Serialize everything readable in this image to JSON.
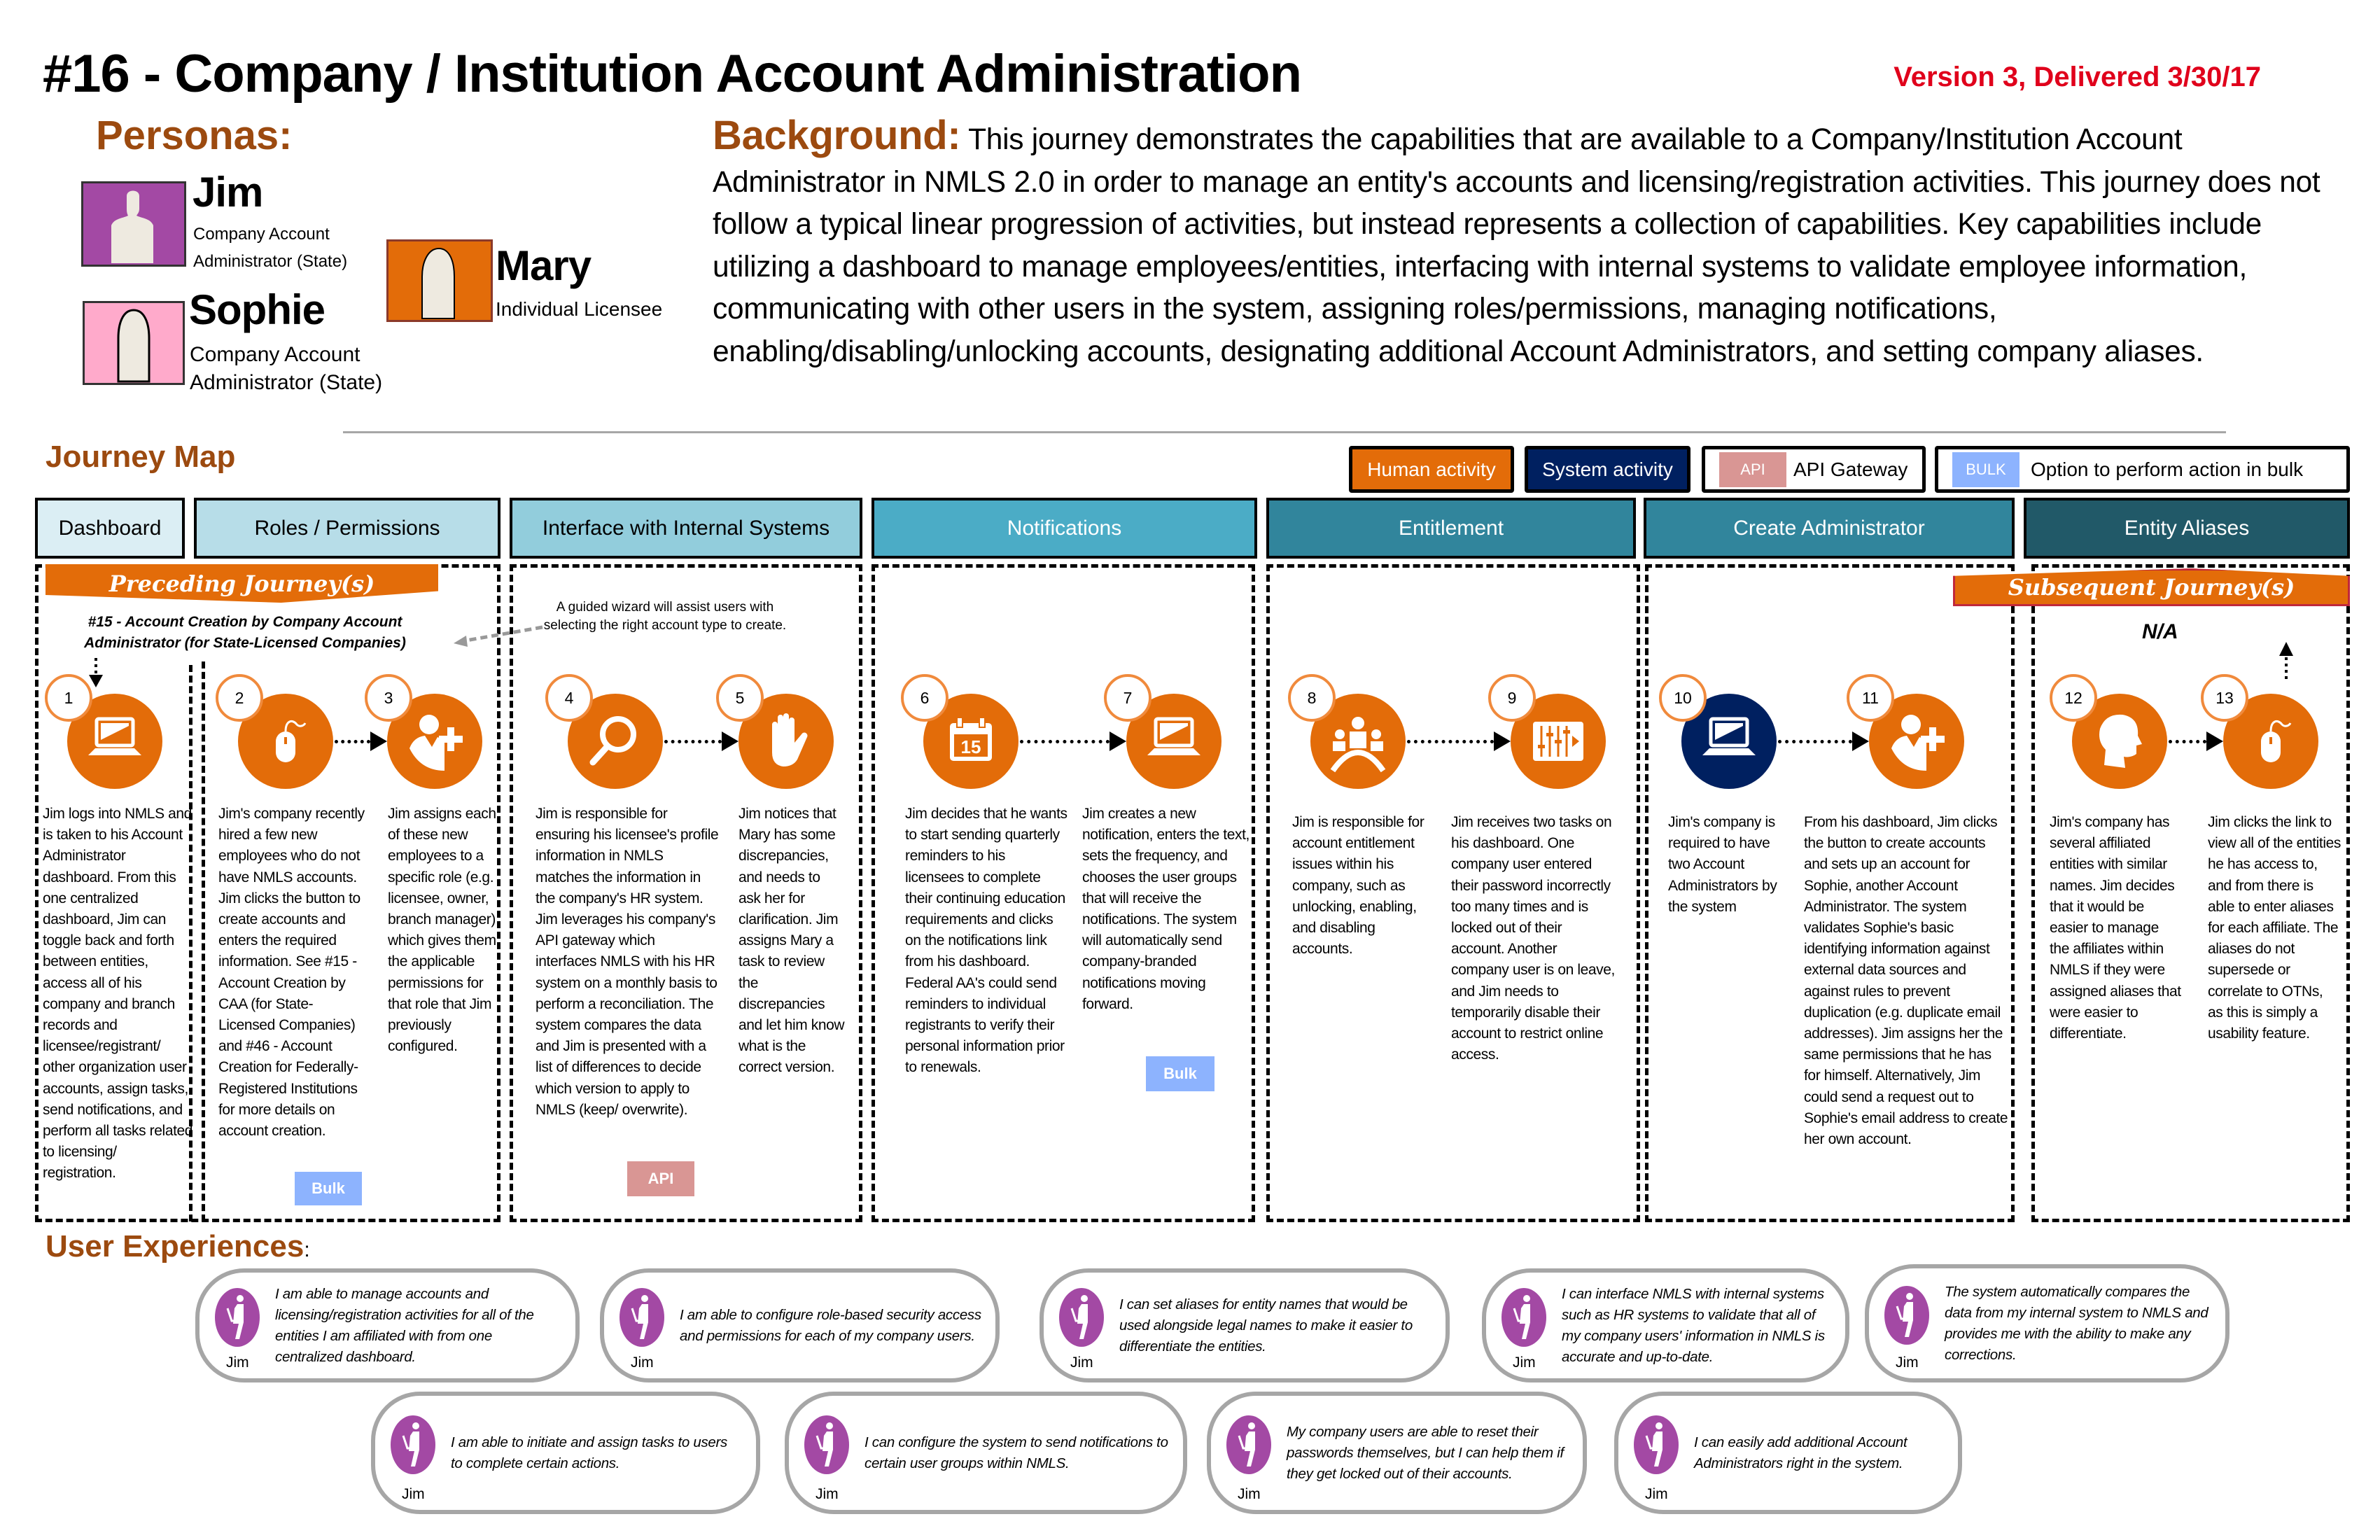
{
  "header": {
    "title": "#16 - Company / Institution Account Administration",
    "version": "Version 3, Delivered 3/30/17"
  },
  "personas": {
    "label": "Personas:",
    "items": [
      {
        "name": "Jim",
        "role_line1": "Company Account",
        "role_line2": "Administrator (State)",
        "color": "#a349a4"
      },
      {
        "name": "Sophie",
        "role_line1": "Company Account",
        "role_line2": "Administrator (State)",
        "color": "#ffaacb"
      },
      {
        "name": "Mary",
        "role_line1": "Individual Licensee",
        "color": "#e36c09"
      }
    ]
  },
  "background": {
    "label": "Background:",
    "text": "This journey demonstrates the capabilities that are available to a Company/Institution Account Administrator in NMLS 2.0 in order to manage an entity's accounts and licensing/registration activities. This journey does not follow a typical linear progression of activities, but instead represents a collection of capabilities. Key capabilities include utilizing a dashboard to manage employees/entities, interfacing with internal systems to validate employee information, communicating with other users in the system, assigning roles/permissions, managing notifications, enabling/disabling/unlocking accounts, designating additional Account Administrators, and setting company aliases."
  },
  "journey_map": {
    "label": "Journey Map",
    "legend": {
      "human": "Human activity",
      "system": "System activity",
      "api_tag": "API",
      "api": "API Gateway",
      "bulk_tag": "BULK",
      "bulk": "Option to perform action in bulk"
    },
    "colors": {
      "human": "#e36c09",
      "system": "#002060",
      "api": "#d99694",
      "bulk": "#8db3fe"
    },
    "phases": [
      {
        "label": "Dashboard",
        "color": "#dbeef4",
        "text_color": "#000"
      },
      {
        "label": "Roles / Permissions",
        "color": "#b7dde8",
        "text_color": "#000"
      },
      {
        "label": "Interface with Internal Systems",
        "color": "#92cddc",
        "text_color": "#000"
      },
      {
        "label": "Notifications",
        "color": "#4bacc6",
        "text_color": "#fff"
      },
      {
        "label": "Entitlement",
        "color": "#31859c",
        "text_color": "#fff"
      },
      {
        "label": "Create Administrator",
        "color": "#31859c",
        "text_color": "#fff"
      },
      {
        "label": "Entity Aliases",
        "color": "#215968",
        "text_color": "#fff"
      }
    ],
    "preceding": {
      "label": "Preceding Journey(s)",
      "line1": "#15 - Account Creation by Company Account",
      "line2": "Administrator (for State-Licensed Companies)"
    },
    "wizard_note": {
      "line1": "A guided wizard will assist users with",
      "line2": "selecting the right account type to create."
    },
    "subsequent": {
      "label": "Subsequent Journey(s)",
      "value": "N/A"
    },
    "steps": [
      {
        "num": "1",
        "icon": "laptop",
        "actor": "human",
        "text": "Jim logs into NMLS and is taken to his Account Administrator dashboard. From this one centralized dashboard, Jim can toggle back and forth between entities, access all of his company and branch records and licensee/registrant/ other organization user accounts, assign tasks, send notifications, and perform all tasks related to licensing/ registration."
      },
      {
        "num": "2",
        "icon": "mouse",
        "actor": "human",
        "tag": "Bulk",
        "text": "Jim's company recently hired a few new employees who do not have NMLS accounts.  Jim clicks the button to create accounts and enters the required information. See #15 - Account Creation by CAA (for State-Licensed Companies) and #46 - Account Creation for Federally-Registered Institutions for more details on account creation."
      },
      {
        "num": "3",
        "icon": "person-add",
        "actor": "human",
        "text": "Jim assigns each of these new employees to a specific role (e.g. licensee, owner, branch manager) which gives them the applicable permissions for that role that Jim previously configured."
      },
      {
        "num": "4",
        "icon": "magnifier",
        "actor": "human",
        "tag": "API",
        "text": "Jim is responsible for ensuring his licensee's profile information in NMLS matches the information in the company's HR system. Jim leverages his company's API gateway which interfaces NMLS with his HR system on a monthly basis to perform a reconciliation. The system compares the data and Jim is presented with a list of differences to decide which version to apply to NMLS (keep/ overwrite)."
      },
      {
        "num": "5",
        "icon": "hand",
        "actor": "human",
        "text": "Jim notices that Mary has some discrepancies, and needs to ask her for clarification. Jim assigns Mary a task to review the discrepancies and let him know what is the correct version."
      },
      {
        "num": "6",
        "icon": "calendar",
        "actor": "human",
        "icon_text": "15",
        "text": "Jim decides that he wants to start sending quarterly reminders to his licensees to complete their continuing education requirements and clicks on the notifications link from his dashboard. Federal AA's could send reminders to individual registrants to verify their personal information prior to renewals."
      },
      {
        "num": "7",
        "icon": "laptop",
        "actor": "human",
        "tag": "Bulk",
        "text": "Jim creates a new notification, enters the text, sets the frequency, and chooses the user groups that will receive the notifications. The system will automatically send company-branded notifications moving forward."
      },
      {
        "num": "8",
        "icon": "group",
        "actor": "human",
        "text": "Jim is responsible for account entitlement issues within his company, such as unlocking, enabling, and disabling accounts."
      },
      {
        "num": "9",
        "icon": "sliders",
        "actor": "human",
        "text": "Jim receives two tasks on his dashboard. One company user entered their password incorrectly too many times and is locked out of their account. Another company user is on leave, and Jim needs to temporarily disable their account to restrict online access."
      },
      {
        "num": "10",
        "icon": "laptop",
        "actor": "system",
        "text": "Jim's company is required to have two Account Administrators by the system"
      },
      {
        "num": "11",
        "icon": "person-add",
        "actor": "human",
        "text": "From his dashboard, Jim clicks the button to create accounts and sets up an account for Sophie, another Account Administrator. The system validates Sophie's basic identifying information against external data sources and against rules to prevent duplication (e.g. duplicate email addresses). Jim assigns her the same permissions that he has for himself. Alternatively, Jim could send a request out to Sophie's email address to create her own account."
      },
      {
        "num": "12",
        "icon": "head",
        "actor": "human",
        "text": "Jim's company has several affiliated entities with similar names.  Jim decides that it would be easier to manage the affiliates within NMLS if they were assigned aliases that were easier to differentiate."
      },
      {
        "num": "13",
        "icon": "mouse",
        "actor": "human",
        "text": "Jim clicks the link to view all of the entities he has access to, and from there is able to enter aliases for each affiliate. The aliases do not supersede or correlate to OTNs, as this is simply a usability feature."
      }
    ]
  },
  "user_experiences": {
    "label": "User Experiences",
    "label_suffix": ":",
    "persona": "Jim",
    "cards": [
      {
        "text": "I am able to manage accounts and licensing/registration activities for all of the entities I am affiliated with from one centralized dashboard."
      },
      {
        "text": "I am able to configure role-based security access and permissions for each of my company users."
      },
      {
        "text": "I can set aliases for entity names that would be used alongside legal names to make it easier to differentiate the entities."
      },
      {
        "text": "I can interface NMLS with internal systems such as HR systems to validate that all of my company users' information in NMLS is accurate and up-to-date."
      },
      {
        "text": "The system automatically compares the data from my internal system to NMLS and provides me with the ability to make any corrections."
      },
      {
        "text": "I am able to initiate and assign tasks to users to complete certain actions."
      },
      {
        "text": "I can configure the system to send notifications to certain user groups within NMLS."
      },
      {
        "text": "My company users are able to reset their passwords themselves, but I can help them if they get locked out of their accounts."
      },
      {
        "text": "I can easily add additional Account Administrators right in the system."
      }
    ]
  }
}
